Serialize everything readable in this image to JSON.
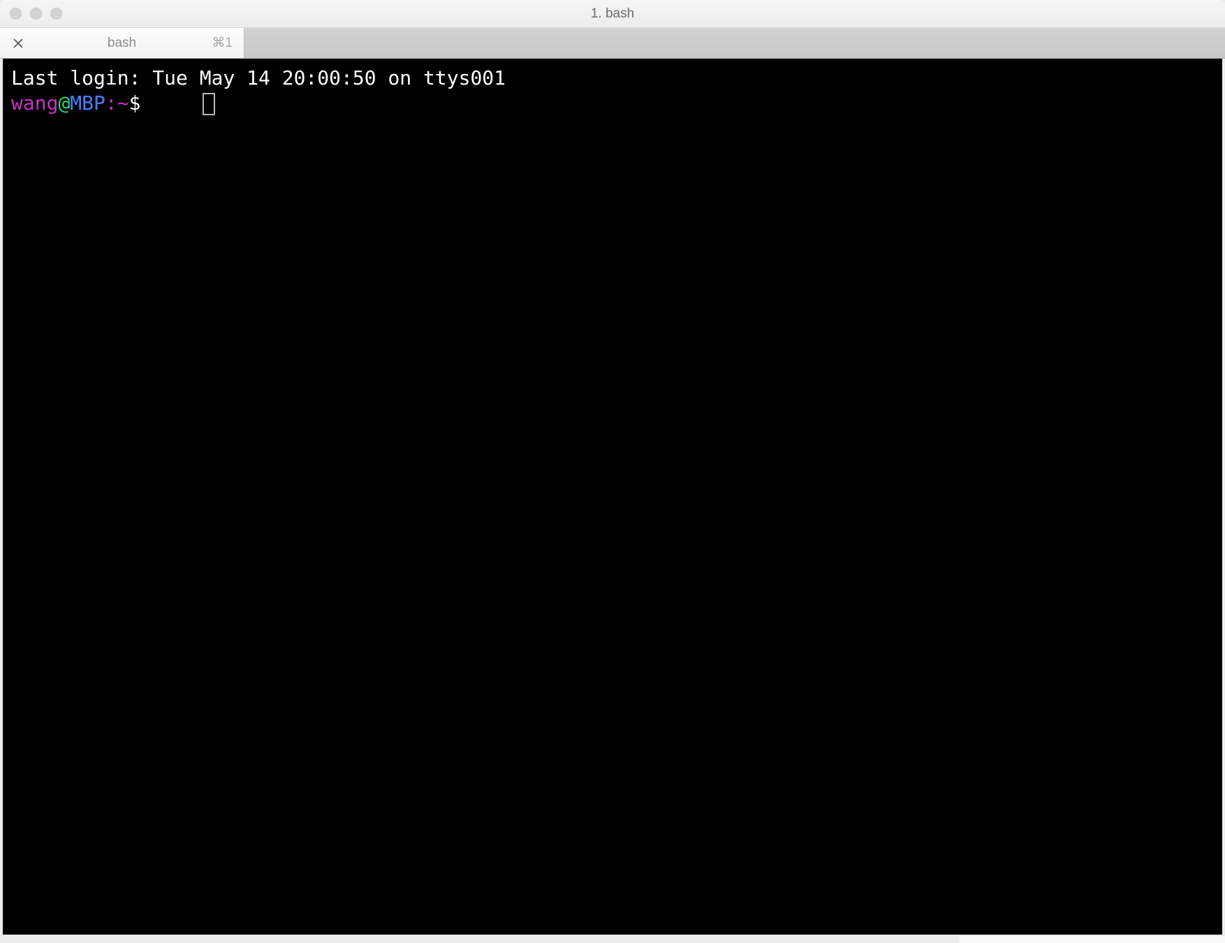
{
  "window": {
    "title": "1. bash"
  },
  "tab": {
    "label": "bash",
    "shortcut": "⌘1"
  },
  "terminal": {
    "last_login": "Last login: Tue May 14 20:00:50 on ttys001",
    "prompt": {
      "user": "wang",
      "at": "@",
      "host": "MBP",
      "colon": ":",
      "cwd": "~",
      "dollar": "$ "
    }
  }
}
